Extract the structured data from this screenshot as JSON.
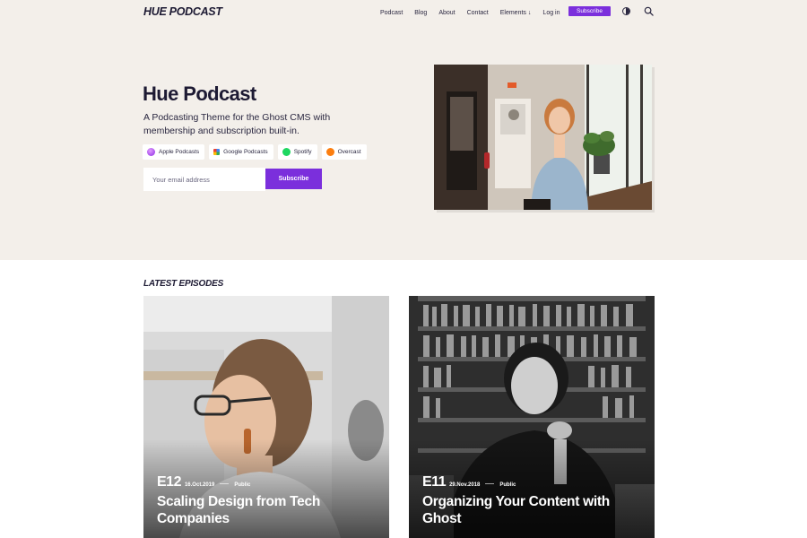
{
  "header": {
    "logo": "HUE PODCAST",
    "nav": [
      {
        "label": "Podcast"
      },
      {
        "label": "Blog"
      },
      {
        "label": "About"
      },
      {
        "label": "Contact"
      },
      {
        "label": "Elements"
      },
      {
        "label": "Log in"
      }
    ],
    "subscribe_label": "Subscribe",
    "icons": [
      "contrast-icon",
      "search-icon",
      "chevron-down-icon"
    ]
  },
  "hero": {
    "title": "Hue Podcast",
    "subtitle": "A Podcasting Theme for the Ghost CMS with membership and subscription built-in.",
    "platforms": [
      {
        "label": "Apple Podcasts",
        "icon": "apple-podcasts-icon",
        "color": "#b85ff0"
      },
      {
        "label": "Google Podcasts",
        "icon": "google-podcasts-icon",
        "color": "#fbbc04"
      },
      {
        "label": "Spotify",
        "icon": "spotify-icon",
        "color": "#1ed760"
      },
      {
        "label": "Overcast",
        "icon": "overcast-icon",
        "color": "#fc7e0f"
      }
    ],
    "email_placeholder": "Your email address",
    "email_submit": "Subscribe"
  },
  "episodes": {
    "title": "LATEST EPISODES",
    "items": [
      {
        "number": "E12",
        "date": "16.Oct.2019",
        "visibility": "Public",
        "title": "Scaling Design from Tech Companies"
      },
      {
        "number": "E11",
        "date": "29.Nov.2018",
        "visibility": "Public",
        "title": "Organizing Your Content with Ghost"
      }
    ]
  },
  "colors": {
    "accent": "#7b2fdc",
    "hero_background": "#f3efea",
    "text": "#1d1a33"
  }
}
